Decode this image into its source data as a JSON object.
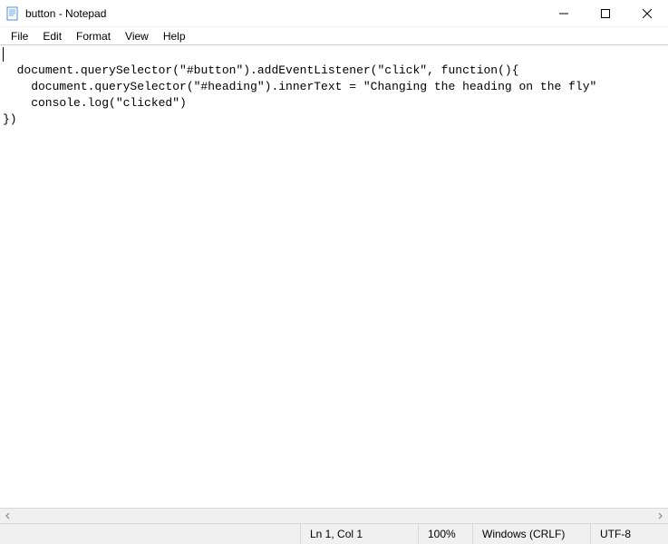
{
  "titlebar": {
    "title": "button - Notepad"
  },
  "menubar": {
    "items": [
      "File",
      "Edit",
      "Format",
      "View",
      "Help"
    ]
  },
  "editor": {
    "content": "document.querySelector(\"#button\").addEventListener(\"click\", function(){\n    document.querySelector(\"#heading\").innerText = \"Changing the heading on the fly\"\n    console.log(\"clicked\")\n})"
  },
  "statusbar": {
    "position": "Ln 1, Col 1",
    "zoom": "100%",
    "line_ending": "Windows (CRLF)",
    "encoding": "UTF-8"
  }
}
